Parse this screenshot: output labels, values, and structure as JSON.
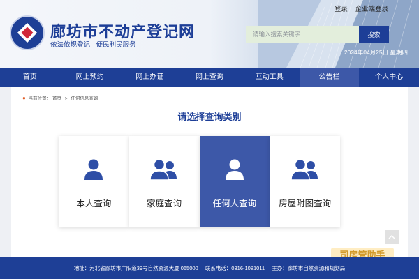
{
  "header": {
    "title": "廊坊市不动产登记网",
    "subtitle": "依法依规登记 便民利民服务",
    "top_links": [
      "登录",
      "企业端登录"
    ],
    "search_placeholder": "请输入搜索关键字",
    "search_button": "搜索",
    "date": "2024年04月25日 星期四",
    "colors": {
      "brand": "#1d3e97",
      "nav_active": "#3d58a8"
    }
  },
  "nav": {
    "items": [
      "首页",
      "网上预约",
      "网上办证",
      "网上查询",
      "互动工具",
      "公告栏",
      "个人中心"
    ],
    "active_index": 5
  },
  "breadcrumb": {
    "label": "当前位置：",
    "home": "首页",
    "current": "任何信息查询"
  },
  "section_title": "请选择查询类别",
  "cards": [
    {
      "label": "本人查询",
      "icon": "person-icon"
    },
    {
      "label": "家庭查询",
      "icon": "family-icon"
    },
    {
      "label": "任何人查询",
      "icon": "person-icon"
    },
    {
      "label": "房屋附图查询",
      "icon": "family-icon"
    }
  ],
  "active_card_index": 2,
  "watermark": "司房管助手",
  "footer": {
    "address": "地址：河北省廊坊市广阳道39号自然资源大厦 065000",
    "phone": "联系电话：0316-1081011",
    "host": "主办：廊坊市自然资源和规划局"
  }
}
